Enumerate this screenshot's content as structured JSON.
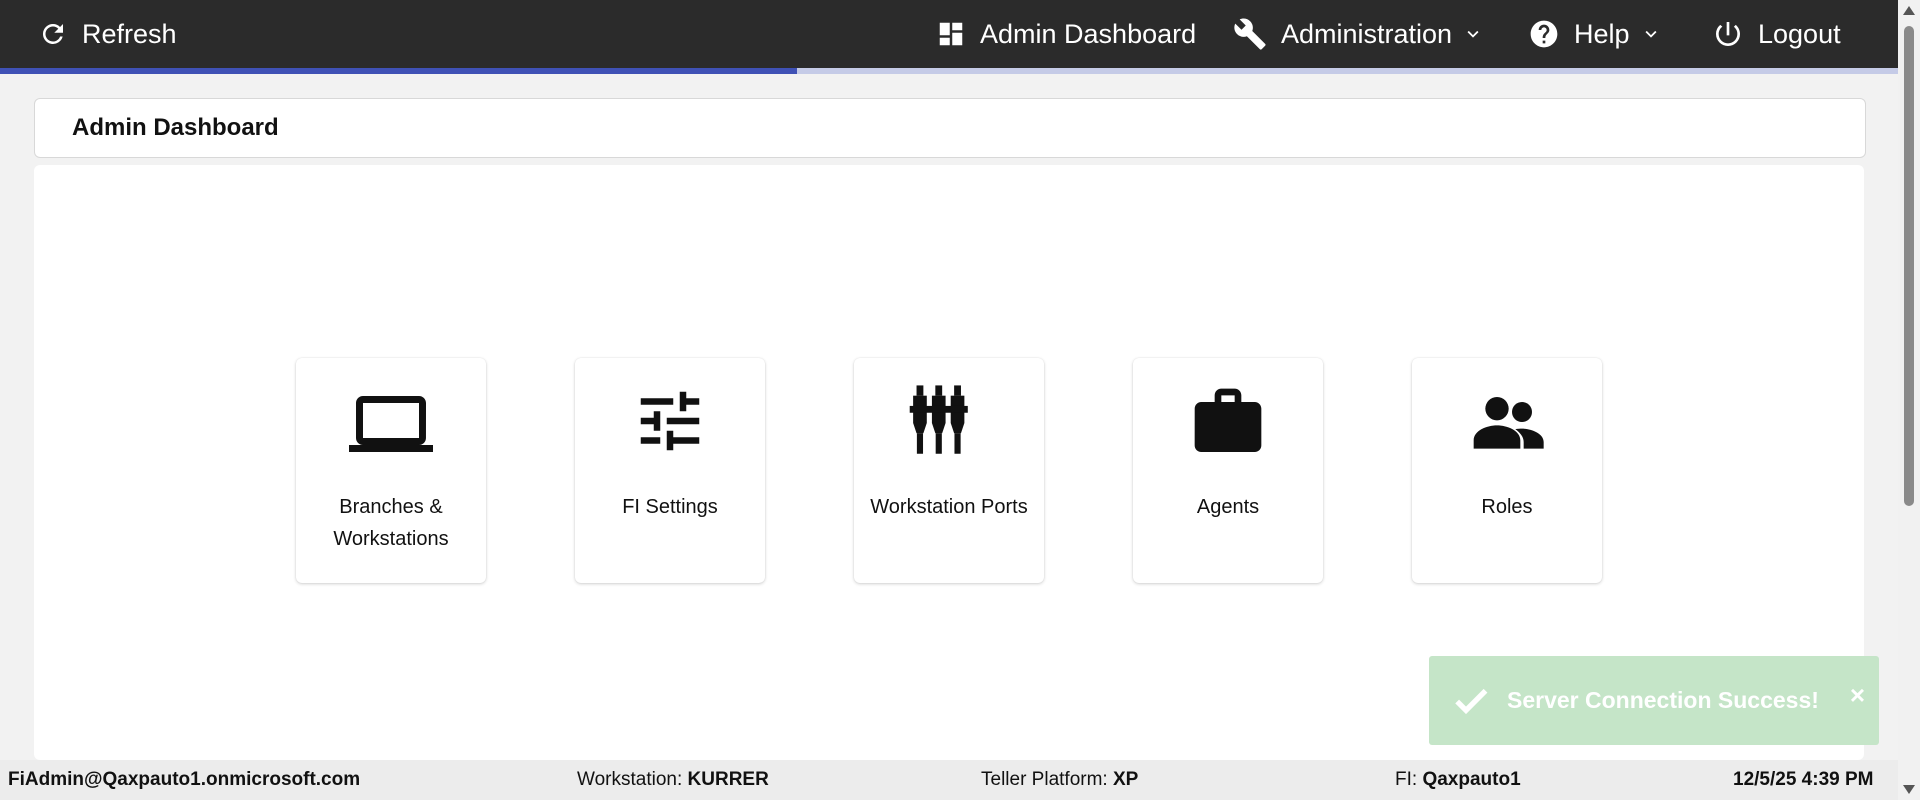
{
  "nav": {
    "refresh": "Refresh",
    "admin_dashboard": "Admin Dashboard",
    "administration": "Administration",
    "help": "Help",
    "logout": "Logout"
  },
  "progress": {
    "percent": 42
  },
  "page_title": "Admin Dashboard",
  "tiles": [
    {
      "label": "Branches & Workstations",
      "icon": "laptop-icon"
    },
    {
      "label": "FI Settings",
      "icon": "sliders-icon"
    },
    {
      "label": "Workstation Ports",
      "icon": "ports-icon"
    },
    {
      "label": "Agents",
      "icon": "briefcase-icon"
    },
    {
      "label": "Roles",
      "icon": "people-icon"
    }
  ],
  "toast": {
    "message": "Server Connection Success!",
    "close": "×",
    "color": "#c5e5c8"
  },
  "footer": {
    "user": "FiAdmin@Qaxpauto1.onmicrosoft.com",
    "workstation_label": "Workstation:",
    "workstation_value": "KURRER",
    "teller_label": "Teller Platform:",
    "teller_value": "XP",
    "fi_label": "FI:",
    "fi_value": "Qaxpauto1",
    "datetime": "12/5/25 4:39 PM"
  },
  "colors": {
    "topbar": "#2b2b2b",
    "progress_fill": "#3f51b5",
    "progress_track": "#c5cbe7"
  }
}
